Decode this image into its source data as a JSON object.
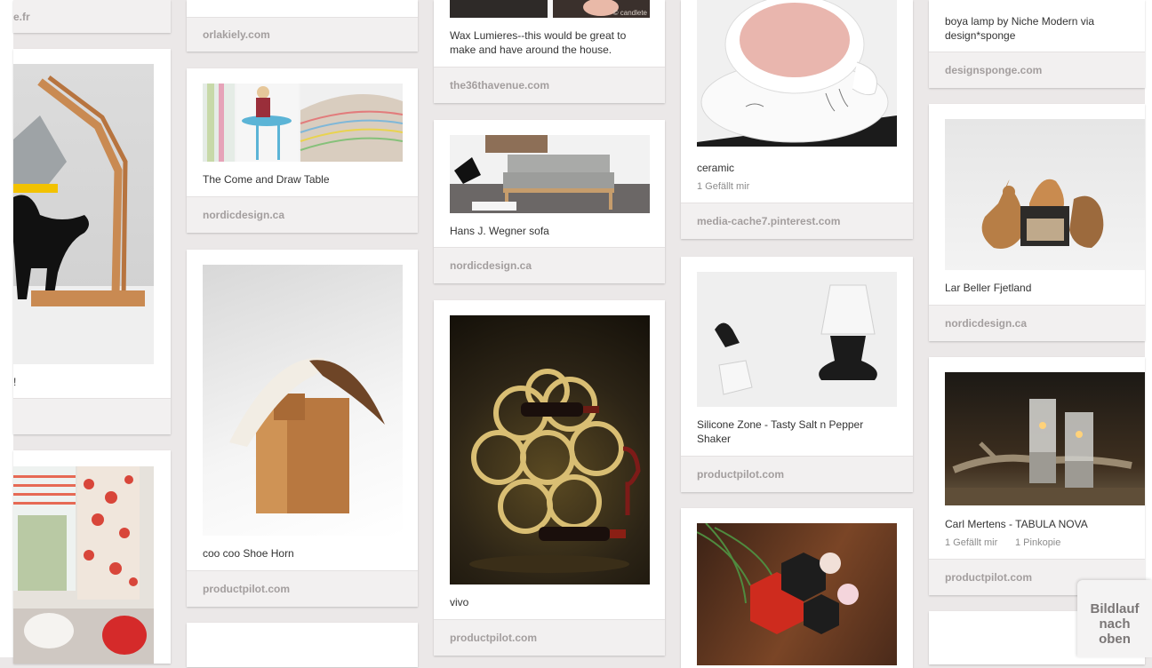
{
  "pins": [
    {
      "id": "partial-top",
      "source": "e.fr"
    },
    {
      "id": "lamp-cat",
      "description": "!"
    },
    {
      "id": "curtain"
    },
    {
      "id": "orla-top",
      "source": "orlakiely.com"
    },
    {
      "id": "draw-table",
      "description": "The Come and Draw Table",
      "source": "nordicdesign.ca"
    },
    {
      "id": "shoe-horn",
      "description": "coo coo Shoe Horn",
      "source": "productpilot.com"
    },
    {
      "id": "bottom-col2"
    },
    {
      "id": "wax",
      "description": "Wax Lumieres--this would be great to make and have around the house.",
      "source": "the36thavenue.com",
      "image_watermark": "© candlete"
    },
    {
      "id": "sofa",
      "description": "Hans J. Wegner sofa",
      "source": "nordicdesign.ca"
    },
    {
      "id": "vivo",
      "description": "vivo",
      "source": "productpilot.com"
    },
    {
      "id": "ceramic",
      "description": "ceramic",
      "likes": "1 Gefällt mir",
      "source": "media-cache7.pinterest.com"
    },
    {
      "id": "salt-pepper",
      "description": "Silicone Zone - Tasty Salt n Pepper Shaker",
      "source": "productpilot.com"
    },
    {
      "id": "hexagon"
    },
    {
      "id": "boya",
      "description": "boya lamp by Niche Modern via design*sponge",
      "source": "designsponge.com"
    },
    {
      "id": "birds",
      "description": "Lar Beller Fjetland",
      "source": "nordicdesign.ca"
    },
    {
      "id": "candles",
      "description": "Carl Mertens - TABULA NOVA",
      "likes": "1 Gefällt mir",
      "repins": "1 Pinkopie",
      "source": "productpilot.com"
    },
    {
      "id": "bottom-col5"
    }
  ],
  "scroll_top": {
    "line1": "Bildlauf",
    "line2": "nach",
    "line3": "oben"
  }
}
